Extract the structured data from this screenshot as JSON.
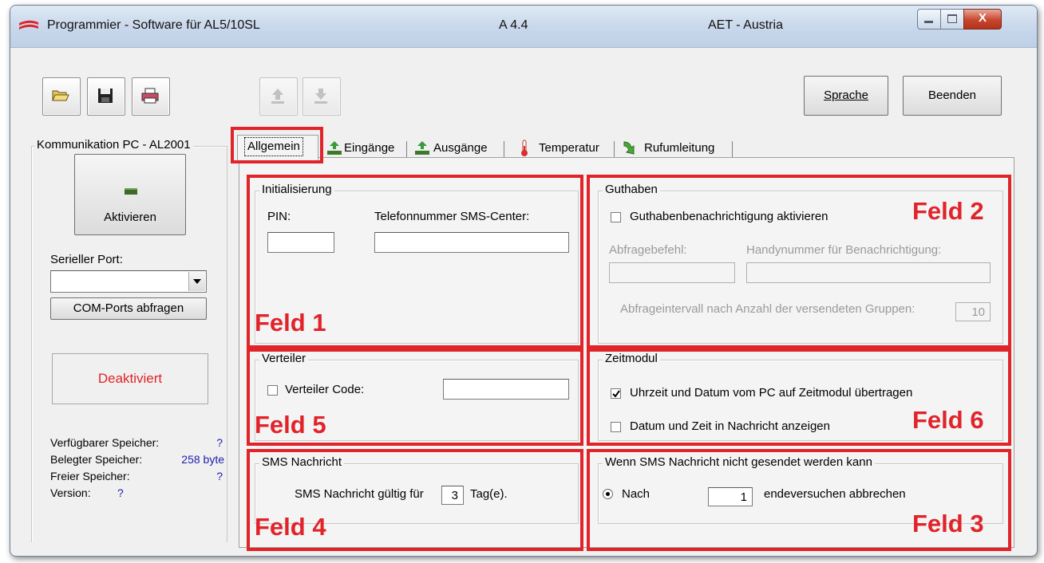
{
  "window": {
    "title": "Programmier - Software für AL5/10SL",
    "version": "A 4.4",
    "company": "AET - Austria",
    "close_glyph": "X"
  },
  "toolbar": {
    "icons": [
      "open-folder-icon",
      "save-disk-icon",
      "printer-icon",
      "upload-icon",
      "download-icon"
    ],
    "sprache_label": "Sprache",
    "beenden_label": "Beenden"
  },
  "sidebar": {
    "group_title": "Kommunikation PC - AL2001",
    "aktivieren_label": "Aktivieren",
    "serial_port_label": "Serieller Port:",
    "serial_port_value": "",
    "com_ports_button": "COM-Ports abfragen",
    "status_label": "Deaktiviert",
    "memory": [
      {
        "label": "Verfügbarer Speicher:",
        "value": "?"
      },
      {
        "label": "Belegter Speicher:",
        "value": "258 byte"
      },
      {
        "label": "Freier Speicher:",
        "value": "?"
      },
      {
        "label": "Version:",
        "value": "?"
      }
    ]
  },
  "tabs": [
    {
      "label": "Allgemein",
      "icon": "",
      "active": true
    },
    {
      "label": "Eingänge",
      "icon": "input-arrows-icon",
      "active": false
    },
    {
      "label": "Ausgänge",
      "icon": "output-arrows-icon",
      "active": false
    },
    {
      "label": "Temperatur",
      "icon": "thermometer-icon",
      "active": false
    },
    {
      "label": "Rufumleitung",
      "icon": "call-forward-icon",
      "active": false
    }
  ],
  "initialisierung": {
    "title": "Initialisierung",
    "pin_label": "PIN:",
    "pin_value": "",
    "sms_center_label": "Telefonnummer SMS-Center:",
    "sms_center_value": ""
  },
  "guthaben": {
    "title": "Guthaben",
    "notify_checkbox_label": "Guthabenbenachrichtigung aktivieren",
    "notify_checked": false,
    "abfragebefehl_label": "Abfragebefehl:",
    "handy_label": "Handynummer für Benachrichtigung:",
    "interval_label": "Abfrageintervall nach Anzahl der versendeten Gruppen:",
    "interval_value": "10"
  },
  "verteiler": {
    "title": "Verteiler",
    "code_label": "Verteiler Code:",
    "code_checked": false,
    "code_value": ""
  },
  "zeitmodul": {
    "title": "Zeitmodul",
    "transfer_label": "Uhrzeit und Datum vom PC auf Zeitmodul übertragen",
    "transfer_checked": true,
    "show_label": "Datum und Zeit in Nachricht anzeigen",
    "show_checked": false
  },
  "sms_nachricht": {
    "title": "SMS Nachricht",
    "valid_prefix": "SMS Nachricht gültig für",
    "valid_value": "3",
    "valid_suffix": "Tag(e)."
  },
  "sms_fail": {
    "title": "Wenn SMS Nachricht nicht gesendet werden kann",
    "radio_label": "Nach",
    "attempts_value": "1",
    "suffix": "endeversuchen abbrechen"
  },
  "annotations": {
    "feld1": "Feld 1",
    "feld2": "Feld 2",
    "feld3": "Feld 3",
    "feld4": "Feld 4",
    "feld5": "Feld 5",
    "feld6": "Feld 6",
    "color": "#e0242a"
  }
}
